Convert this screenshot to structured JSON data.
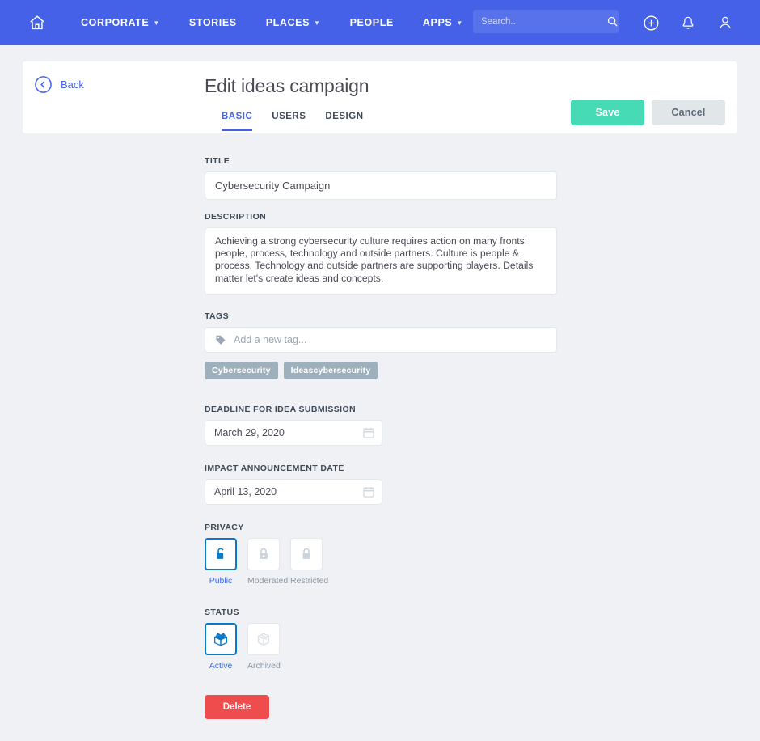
{
  "colors": {
    "nav_bg": "#4461e8",
    "page_bg": "#eff1f4",
    "accent_blue": "#4461e8",
    "save_green": "#46dbb4",
    "cancel_gray": "#e1e6e9",
    "delete_red": "#ef4d4d",
    "tag_gray": "#9fb0bd",
    "selected_blue": "#0a7ac8"
  },
  "nav": {
    "home_icon": "home-icon",
    "items": [
      {
        "label": "CORPORATE",
        "has_caret": true
      },
      {
        "label": "STORIES",
        "has_caret": false
      },
      {
        "label": "PLACES",
        "has_caret": true
      },
      {
        "label": "PEOPLE",
        "has_caret": false
      },
      {
        "label": "APPS",
        "has_caret": true
      }
    ],
    "search": {
      "placeholder": "Search...",
      "value": "",
      "icon": "search-icon"
    },
    "right_icons": [
      {
        "name": "plus-circle-icon"
      },
      {
        "name": "bell-icon"
      },
      {
        "name": "user-icon"
      }
    ]
  },
  "header": {
    "back_label": "Back",
    "back_icon": "chevron-left-circle-icon",
    "title": "Edit ideas campaign",
    "tabs": [
      {
        "label": "BASIC",
        "active": true
      },
      {
        "label": "USERS",
        "active": false
      },
      {
        "label": "DESIGN",
        "active": false
      }
    ],
    "save_label": "Save",
    "cancel_label": "Cancel"
  },
  "form": {
    "title": {
      "label": "TITLE",
      "value": "Cybersecurity Campaign"
    },
    "description": {
      "label": "DESCRIPTION",
      "value": "Achieving a strong cybersecurity culture requires action on many fronts: people, process, technology and outside partners. Culture is people & process. Technology and outside partners are supporting players. Details matter let's create ideas and concepts."
    },
    "tags": {
      "label": "TAGS",
      "placeholder": "Add a new tag...",
      "value": "",
      "icon": "tag-icon",
      "items": [
        "Cybersecurity",
        "Ideascybersecurity"
      ]
    },
    "deadline": {
      "label": "DEADLINE FOR IDEA SUBMISSION",
      "value": "March 29, 2020",
      "icon": "calendar-icon"
    },
    "impact_date": {
      "label": "IMPACT ANNOUNCEMENT DATE",
      "value": "April 13, 2020",
      "icon": "calendar-icon"
    },
    "privacy": {
      "label": "PRIVACY",
      "options": [
        {
          "label": "Public",
          "icon": "unlocked-padlock-icon",
          "selected": true
        },
        {
          "label": "Moderated",
          "icon": "lock-plus-icon",
          "selected": false
        },
        {
          "label": "Restricted",
          "icon": "locked-padlock-icon",
          "selected": false
        }
      ]
    },
    "status": {
      "label": "STATUS",
      "options": [
        {
          "label": "Active",
          "icon": "open-box-icon",
          "selected": true
        },
        {
          "label": "Archived",
          "icon": "closed-box-icon",
          "selected": false
        }
      ]
    },
    "delete_label": "Delete"
  }
}
